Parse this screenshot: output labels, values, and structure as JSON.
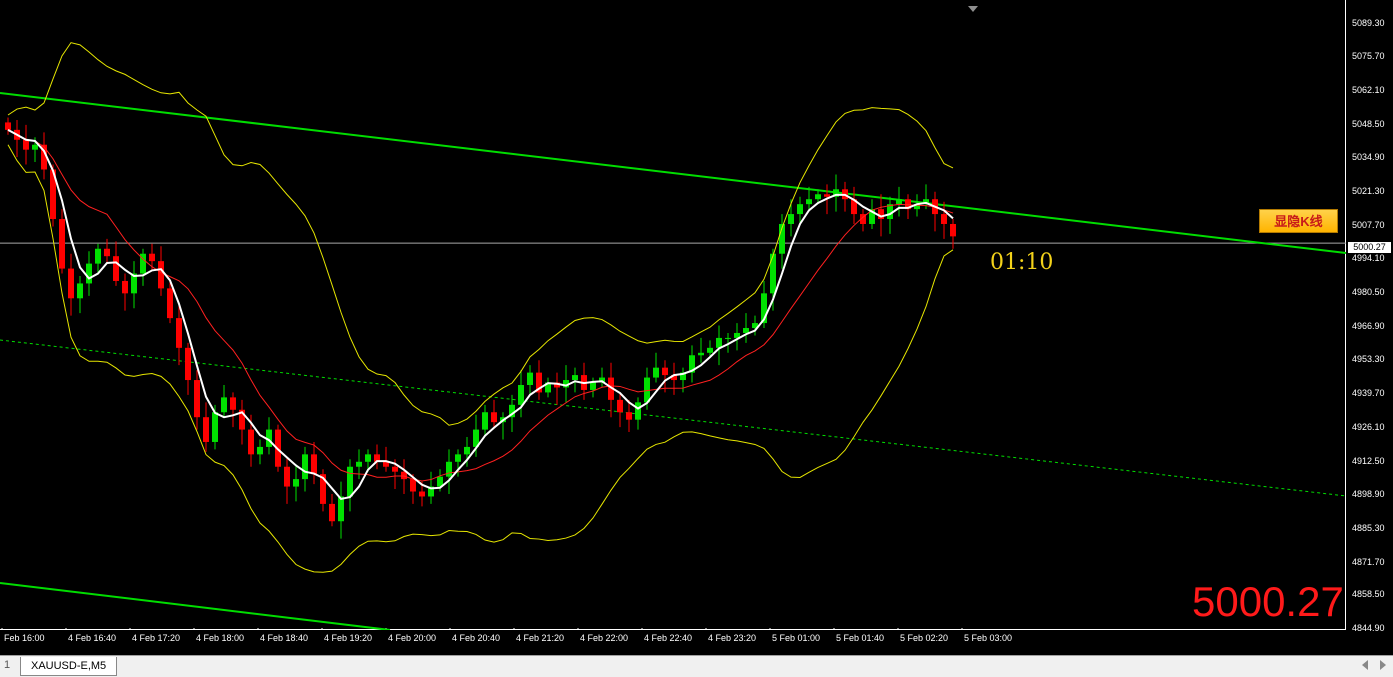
{
  "chart": {
    "symbol_tab": "XAUUSD-E,M5",
    "tab_index": "1",
    "current_price": "5000.27",
    "big_price": "5000.27",
    "countdown": "01:10",
    "toggle_button": "显隐K线",
    "y_ticks": [
      "5089.30",
      "5075.70",
      "5062.10",
      "5048.50",
      "5034.90",
      "5021.30",
      "5007.70",
      "4994.10",
      "4980.50",
      "4966.90",
      "4953.30",
      "4939.70",
      "4926.10",
      "4912.50",
      "4898.90",
      "4885.30",
      "4871.70",
      "4858.50",
      "4844.90"
    ],
    "x_ticks": [
      "Feb 16:00",
      "4 Feb 16:40",
      "4 Feb 17:20",
      "4 Feb 18:00",
      "4 Feb 18:40",
      "4 Feb 19:20",
      "4 Feb 20:00",
      "4 Feb 20:40",
      "4 Feb 21:20",
      "4 Feb 22:00",
      "4 Feb 22:40",
      "4 Feb 23:20",
      "5 Feb 01:00",
      "5 Feb 01:40",
      "5 Feb 02:20",
      "5 Feb 03:00"
    ],
    "colors": {
      "bull": "#00e000",
      "bear": "#ff0000",
      "channel": "#00dd00",
      "bollinger": "#e6e600",
      "ma_fast": "#ffffff",
      "ma_slow": "#ff2020"
    }
  },
  "chart_data": {
    "type": "candlestick",
    "symbol": "XAUUSD-E",
    "timeframe": "M5",
    "ylim": [
      4844.9,
      5096.0
    ],
    "close_series": [
      5046,
      5042,
      5038,
      5040,
      5030,
      5010,
      4990,
      4978,
      4984,
      4992,
      4998,
      4995,
      4985,
      4980,
      4988,
      4996,
      4993,
      4982,
      4970,
      4958,
      4945,
      4930,
      4920,
      4932,
      4938,
      4933,
      4925,
      4915,
      4918,
      4925,
      4910,
      4902,
      4905,
      4915,
      4907,
      4895,
      4888,
      4898,
      4910,
      4912,
      4915,
      4912,
      4910,
      4908,
      4905,
      4900,
      4898,
      4902,
      4906,
      4912,
      4915,
      4918,
      4925,
      4932,
      4928,
      4930,
      4935,
      4943,
      4948,
      4940,
      4944,
      4942,
      4945,
      4947,
      4941,
      4944,
      4946,
      4937,
      4932,
      4929,
      4936,
      4946,
      4950,
      4947,
      4945,
      4948,
      4955,
      4956,
      4958,
      4962,
      4962,
      4964,
      4966,
      4968,
      4980,
      4996,
      5008,
      5012,
      5016,
      5018,
      5020,
      5019,
      5022,
      5018,
      5012,
      5008,
      5014,
      5010,
      5016,
      5018,
      5014,
      5016,
      5018,
      5012,
      5008,
      5003
    ],
    "reference_price": 5000.27
  }
}
